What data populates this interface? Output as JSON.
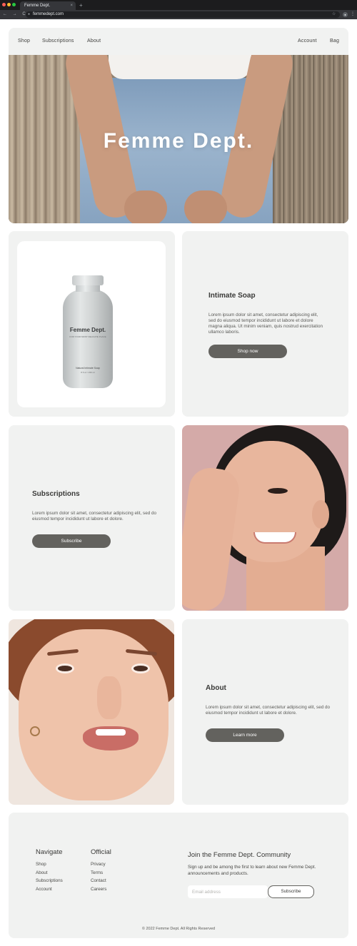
{
  "browser": {
    "tab_title": "Femme Dept.",
    "tab_close": "×",
    "new_tab": "+",
    "url": "femmedept.com",
    "nav_icons": "← → C"
  },
  "nav": {
    "shop": "Shop",
    "subscriptions": "Subscriptions",
    "about": "About",
    "account": "Account",
    "bag": "Bag"
  },
  "hero": {
    "title": "Femme Dept."
  },
  "product": {
    "bottle_brand": "Femme Dept.",
    "bottle_tagline": "FOR YOUR MOST DELICATE PLACE",
    "bottle_name": "Natural Intimate Soap",
    "bottle_size": "8 fl oz / 236 ml"
  },
  "soap": {
    "title": "Intimate Soap",
    "body": "Lorem ipsum dolor sit amet, consectetur adipiscing elit, sed do eiusmod tempor incididunt ut labore et dolore magna aliqua. Ut  minim veniam, quis nostrud exercitation ullamco laboris.",
    "button": "Shop now"
  },
  "subscriptions": {
    "title": "Subscriptions",
    "body": "Lorem ipsum dolor sit amet, consectetur adipiscing elit, sed do eiusmod tempor incididunt ut labore et dolore.",
    "button": "Subscribe"
  },
  "about": {
    "title": "About",
    "body": "Lorem ipsum dolor sit amet, consectetur adipiscing elit, sed do eiusmod tempor incididunt ut labore et dolore.",
    "button": "Learn more"
  },
  "footer": {
    "navigate_title": "Navigate",
    "navigate_links": [
      "Shop",
      "About",
      "Subscriptions",
      "Account"
    ],
    "official_title": "Official",
    "official_links": [
      "Privacy",
      "Terms",
      "Contact",
      "Careers"
    ],
    "community_title": "Join the Femme Dept. Community",
    "community_text": "Sign up and be among the first to learn about new Femme Dept. announcements and products.",
    "email_placeholder": "Email address",
    "subscribe_button": "Subscribe",
    "copyright": "© 2022 Femme Dept. All Rights Reserved"
  },
  "colors": {
    "card_bg": "#f1f2f1",
    "button_bg": "#63625e",
    "text": "#3a3a38"
  }
}
